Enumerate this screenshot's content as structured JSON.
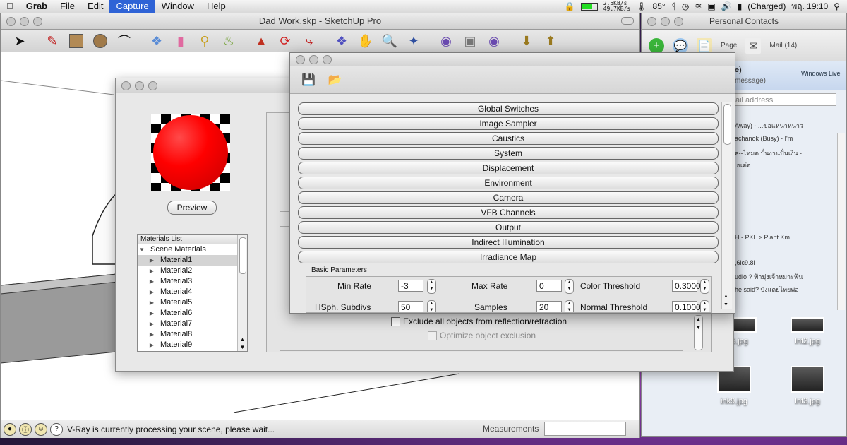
{
  "menubar": {
    "app": "Grab",
    "items": [
      "File",
      "Edit",
      "Capture",
      "Window",
      "Help"
    ],
    "active": "Capture",
    "net_up": "2.5KB/s",
    "net_down": "49.7KB/s",
    "temp": "85°",
    "battery": "(Charged)",
    "clock": "พฤ. 19:10"
  },
  "sketchup": {
    "title": "Dad Work.skp - SketchUp Pro",
    "status_text": "V-Ray is currently processing your scene, please wait...",
    "measurements_label": "Measurements"
  },
  "messenger": {
    "title": "Personal Contacts",
    "toolbar_labels": [
      "Page",
      "Mail (14)"
    ],
    "status_line1": "e)",
    "status_line2": "message)",
    "windows_live": "Windows Live",
    "search_placeholder": "ail address",
    "contacts": [
      "Away) - ...ขอแหน่าหนาว",
      "achanok (Busy) - I'm",
      "ล--โหมด ปั่นงานปั่นเงิน -",
      "้ อเค่อ"
    ],
    "contacts2": [
      "H - PKL > Plant Km",
      ",6ic9.8i",
      "udio ? ฟ้ามุ่งเจ้าหมาะฟ้น",
      "he said? บังแดยไทยพ่อ"
    ]
  },
  "desktop_icons": [
    {
      "label": "5.jpg"
    },
    {
      "label": "Int2.jpg"
    },
    {
      "label": "ink9.jpg"
    },
    {
      "label": "Int3.jpg"
    }
  ],
  "material_editor": {
    "preview_label": "Preview",
    "list_header": "Materials List",
    "scene_materials": "Scene Materials",
    "materials": [
      "Material1",
      "Material2",
      "Material3",
      "Material4",
      "Material5",
      "Material6",
      "Material7",
      "Material8",
      "Material9"
    ],
    "selected": "Material1",
    "exclude_label": "Exclude all objects from reflection/refraction",
    "optimize_label": "Optimize object exclusion"
  },
  "render_options": {
    "rollouts": [
      "Global Switches",
      "Image Sampler",
      "Caustics",
      "System",
      "Displacement",
      "Environment",
      "Camera",
      "VFB Channels",
      "Output",
      "Indirect Illumination",
      "Irradiance Map"
    ],
    "section": "Basic Parameters",
    "min_rate_label": "Min Rate",
    "min_rate": "-3",
    "max_rate_label": "Max Rate",
    "max_rate": "0",
    "color_threshold_label": "Color Threshold",
    "color_threshold": "0.3000",
    "hsph_label": "HSph. Subdivs",
    "hsph": "50",
    "samples_label": "Samples",
    "samples": "20",
    "normal_threshold_label": "Normal Threshold",
    "normal_threshold": "0.1000"
  }
}
